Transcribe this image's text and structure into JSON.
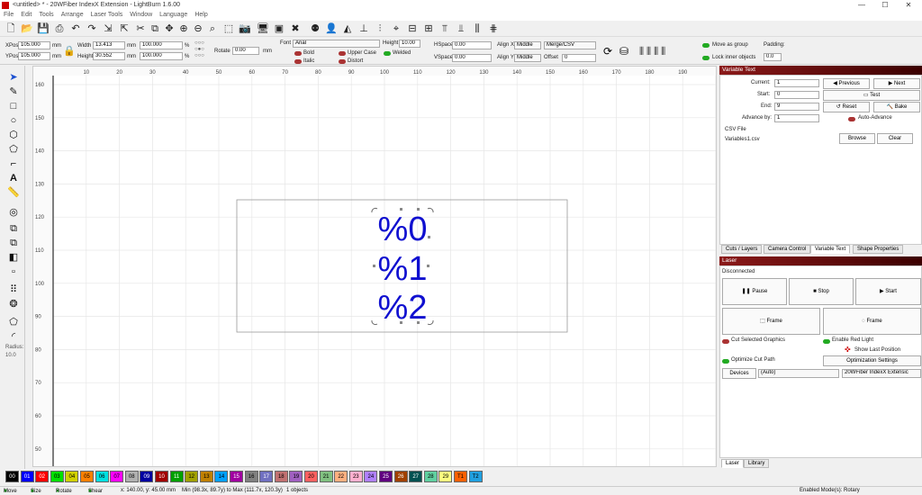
{
  "window": {
    "title": "<untitled> * - 20WFiber IndexX Extension - LightBurn 1.6.00",
    "controls": [
      "—",
      "☐",
      "✕"
    ]
  },
  "menu": [
    "File",
    "Edit",
    "Tools",
    "Arrange",
    "Laser Tools",
    "Window",
    "Language",
    "Help"
  ],
  "toolbar_icons": [
    "new-file-icon",
    "open-file-icon",
    "save-icon",
    "print-icon",
    "undo-icon",
    "redo-icon",
    "import-icon",
    "export-icon",
    "cut-icon",
    "copy-icon",
    "paste-icon",
    "move-icon",
    "zoom-in-icon",
    "zoom-out-icon",
    "zoom-frame-icon",
    "select-frame-icon",
    "camera-icon",
    "monitor-icon",
    "devices-icon",
    "settings-icon",
    "tools-icon",
    "group-icon",
    "ungroup-icon",
    "user-icon",
    "mirror-icon",
    "align-center-icon",
    "align-vertical-icon",
    "distribute-icon",
    "distribute-v-icon",
    "target-icon",
    "center-h-icon",
    "center-v-icon",
    "grid-icon",
    "align-top-icon",
    "align-bottom-icon"
  ],
  "numeric": {
    "xpos_label": "XPos",
    "xpos": "105.000",
    "ypos_label": "YPos",
    "ypos": "105.000",
    "unit": "mm",
    "width_label": "Width",
    "width": "13.413",
    "height_label": "Height",
    "height": "30.552",
    "scale_w": "100.000",
    "scale_h": "100.000",
    "percent": "%",
    "rotate_label": "Rotate",
    "rotate": "0.00"
  },
  "text_options": {
    "font_label": "Font",
    "font": "Arial",
    "height_label": "Height",
    "height": "10.00",
    "hspace_label": "HSpace",
    "hspace": "0.00",
    "vspace_label": "VSpace",
    "vspace": "0.00",
    "alignx_label": "Align X",
    "alignx": "Middle",
    "aligny_label": "Align Y",
    "aligny": "Middle",
    "mode": "Merge/CSV",
    "offset_label": "Offset",
    "offset": "0",
    "bold": "Bold",
    "italic": "Italic",
    "upper_case": "Upper Case",
    "distort": "Distort",
    "welded": "Welded"
  },
  "group_options": {
    "move_as_group": "Move as group",
    "lock_inner": "Lock inner objects",
    "padding_label": "Padding:",
    "padding": "0.0"
  },
  "left_tools": {
    "radius_label": "Radius:",
    "radius": "10.0"
  },
  "rulers": {
    "top": [
      "10",
      "20",
      "30",
      "40",
      "50",
      "60",
      "70",
      "80",
      "90",
      "100",
      "110",
      "120",
      "130",
      "140",
      "150",
      "160",
      "170",
      "180",
      "190"
    ],
    "left": [
      "160",
      "150",
      "140",
      "130",
      "120",
      "110",
      "100",
      "90",
      "80",
      "70",
      "60",
      "50"
    ]
  },
  "canvas_texts": [
    "%0",
    "%1",
    "%2"
  ],
  "variable_text": {
    "title": "Variable Text",
    "current_label": "Current:",
    "current": "1",
    "start_label": "Start:",
    "start": "0",
    "end_label": "End:",
    "end": "9",
    "advance_label": "Advance by:",
    "advance": "1",
    "previous": "Previous",
    "next": "Next",
    "test": "Test",
    "reset": "Reset",
    "bake": "Bake",
    "auto_advance": "Auto-Advance",
    "csv_label": "CSV File",
    "csv_file": "Variables1.csv",
    "browse": "Browse",
    "clear": "Clear"
  },
  "panel_tabs": [
    "Cuts / Layers",
    "Camera Control",
    "Variable Text",
    "Shape Properties"
  ],
  "laser": {
    "title": "Laser",
    "status": "Disconnected",
    "pause": "Pause",
    "stop": "Stop",
    "start": "Start",
    "frame1": "Frame",
    "frame2": "Frame",
    "cut_selected": "Cut Selected Graphics",
    "red_light": "Enable Red Light",
    "show_last": "Show Last Position",
    "optimize": "Optimize Cut Path",
    "opt_settings": "Optimization Settings",
    "devices": "Devices",
    "auto": "(Auto)",
    "device_name": "20WFiber IndexX Extensic"
  },
  "bottom_tabs": [
    "Laser",
    "Library"
  ],
  "palette": [
    {
      "label": "00",
      "color": "#000000",
      "fg": "#ffffff"
    },
    {
      "label": "01",
      "color": "#0000ff",
      "fg": "#ffffff"
    },
    {
      "label": "02",
      "color": "#ff0000",
      "fg": "#ffffff"
    },
    {
      "label": "03",
      "color": "#00e000",
      "fg": "#000000"
    },
    {
      "label": "04",
      "color": "#d0d000",
      "fg": "#000000"
    },
    {
      "label": "05",
      "color": "#ff8000",
      "fg": "#000000"
    },
    {
      "label": "06",
      "color": "#00e0e0",
      "fg": "#000000"
    },
    {
      "label": "07",
      "color": "#ff00ff",
      "fg": "#000000"
    },
    {
      "label": "08",
      "color": "#b0b0b0",
      "fg": "#000000"
    },
    {
      "label": "09",
      "color": "#0000a0",
      "fg": "#ffffff"
    },
    {
      "label": "10",
      "color": "#a00000",
      "fg": "#ffffff"
    },
    {
      "label": "11",
      "color": "#00a000",
      "fg": "#ffffff"
    },
    {
      "label": "12",
      "color": "#a0a000",
      "fg": "#000000"
    },
    {
      "label": "13",
      "color": "#c08000",
      "fg": "#000000"
    },
    {
      "label": "14",
      "color": "#00a0ff",
      "fg": "#000000"
    },
    {
      "label": "15",
      "color": "#a000a0",
      "fg": "#ffffff"
    },
    {
      "label": "16",
      "color": "#808080",
      "fg": "#000000"
    },
    {
      "label": "17",
      "color": "#7070c0",
      "fg": "#ffffff"
    },
    {
      "label": "18",
      "color": "#c07070",
      "fg": "#000000"
    },
    {
      "label": "19",
      "color": "#a060c0",
      "fg": "#000000"
    },
    {
      "label": "20",
      "color": "#ff6060",
      "fg": "#000000"
    },
    {
      "label": "21",
      "color": "#80c080",
      "fg": "#000000"
    },
    {
      "label": "22",
      "color": "#ffb080",
      "fg": "#000000"
    },
    {
      "label": "23",
      "color": "#ffb0d0",
      "fg": "#000000"
    },
    {
      "label": "24",
      "color": "#b080ff",
      "fg": "#000000"
    },
    {
      "label": "25",
      "color": "#600080",
      "fg": "#ffffff"
    },
    {
      "label": "26",
      "color": "#a04000",
      "fg": "#ffffff"
    },
    {
      "label": "27",
      "color": "#005050",
      "fg": "#ffffff"
    },
    {
      "label": "28",
      "color": "#60d0a0",
      "fg": "#000000"
    },
    {
      "label": "29",
      "color": "#ffff80",
      "fg": "#000000"
    },
    {
      "label": "T1",
      "color": "#ff6000",
      "fg": "#000000"
    },
    {
      "label": "T2",
      "color": "#20a0e0",
      "fg": "#000000"
    }
  ],
  "status": {
    "move": "Move",
    "size": "Size",
    "rotate": "Rotate",
    "shear": "Shear",
    "coords": "x: 140.00, y: 45.00 mm",
    "bounds": "Min (98.3x, 89.7y) to Max (111.7x, 120.3y)",
    "objects": "1 objects",
    "mode": "Enabled Mode(s): Rotary"
  }
}
